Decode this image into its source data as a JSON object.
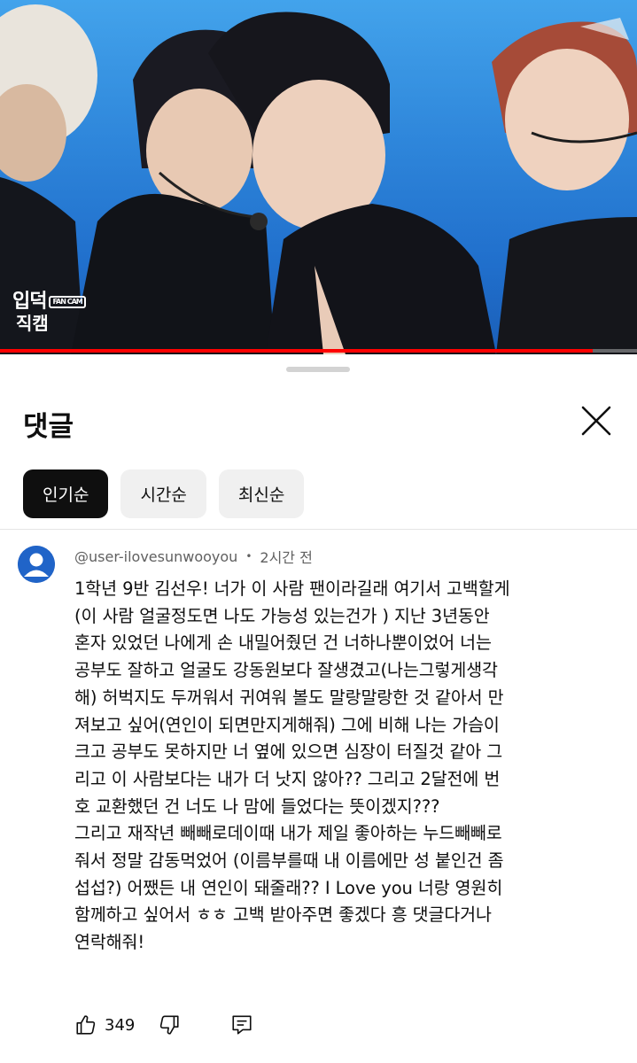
{
  "video": {
    "logo_line1": "입덕",
    "logo_badge": "FAN CAM",
    "logo_line2": "직캠",
    "progress": 0.93,
    "progress_color": "#ff0000"
  },
  "comments_sheet": {
    "title": "댓글",
    "close_icon": "close-icon",
    "sort_chips": [
      {
        "label": "인기순",
        "active": true
      },
      {
        "label": "시간순",
        "active": false
      },
      {
        "label": "최신순",
        "active": false
      }
    ]
  },
  "comment": {
    "author": "@user-ilovesunwooyou",
    "separator": "•",
    "time": "2시간 전",
    "text": "1학년 9반 김선우! 너가 이 사람 팬이라길래 여기서 고백할게\n(이 사람 얼굴정도면 나도 가능성 있는건가 ) 지난 3년동안\n혼자 있었던 나에게 손 내밀어줬던 건 너하나뿐이었어 너는\n공부도 잘하고 얼굴도 강동원보다 잘생겼고(나는그렇게생각\n해) 허벅지도 두꺼워서 귀여워 볼도 말랑말랑한 것 같아서 만\n져보고 싶어(연인이 되면만지게해줘) 그에 비해 나는 가슴이\n크고 공부도 못하지만 너 옆에 있으면 심장이 터질것 같아 그\n리고 이 사람보다는 내가 더 낫지 않아?? 그리고 2달전에 번\n호 교환했던 건 너도 나 맘에 들었다는 뜻이겠지???\n그리고 재작년 빼빼로데이때 내가 제일 좋아하는 누드빼빼로\n줘서 정말 감동먹었어 (이름부를때 내 이름에만 성 붙인건 좀\n섭섭?) 어쨌든 내 연인이 돼줄래?? I Love you 너랑 영원히\n함께하고 싶어서 ㅎㅎ 고백 받아주면 좋겠다 흥 댓글다거나\n연락해줘!",
    "like_count": "349",
    "icons": [
      "thumbs-up-icon",
      "thumbs-down-icon",
      "reply-icon"
    ]
  }
}
